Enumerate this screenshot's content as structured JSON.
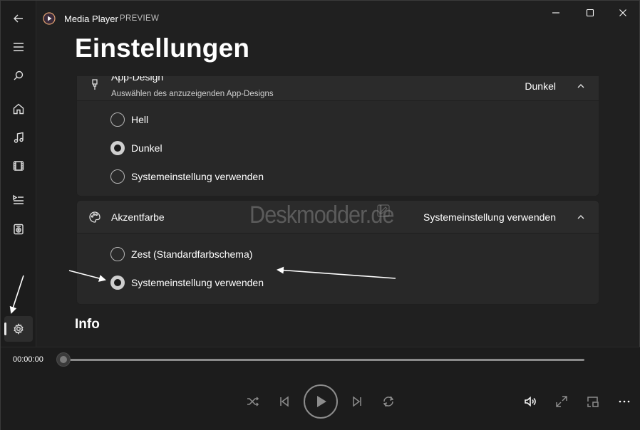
{
  "window": {
    "app_title": "Media Player",
    "app_badge": "PREVIEW"
  },
  "page": {
    "title": "Einstellungen"
  },
  "theme_card": {
    "title": "App-Design",
    "subtitle": "Auswählen des anzuzeigenden App-Designs",
    "value": "Dunkel",
    "options": [
      {
        "label": "Hell",
        "selected": false
      },
      {
        "label": "Dunkel",
        "selected": true
      },
      {
        "label": "Systemeinstellung verwenden",
        "selected": false
      }
    ]
  },
  "accent_card": {
    "title": "Akzentfarbe",
    "value": "Systemeinstellung verwenden",
    "options": [
      {
        "label": "Zest (Standardfarbschema)",
        "selected": false
      },
      {
        "label": "Systemeinstellung verwenden",
        "selected": true
      }
    ]
  },
  "info_section": {
    "title": "Info"
  },
  "watermark": {
    "text": "Deskmodder.de"
  },
  "player": {
    "time": "00:00:00",
    "progress": 0
  },
  "icons": {
    "sidebar": [
      "back-icon",
      "menu-icon",
      "search-icon",
      "home-icon",
      "music-icon",
      "video-icon",
      "playlist-icon",
      "radio-icon",
      "settings-icon"
    ],
    "player": [
      "shuffle-icon",
      "previous-icon",
      "play-icon",
      "next-icon",
      "repeat-icon",
      "volume-icon",
      "fullscreen-icon",
      "miniplayer-icon",
      "more-icon"
    ]
  }
}
